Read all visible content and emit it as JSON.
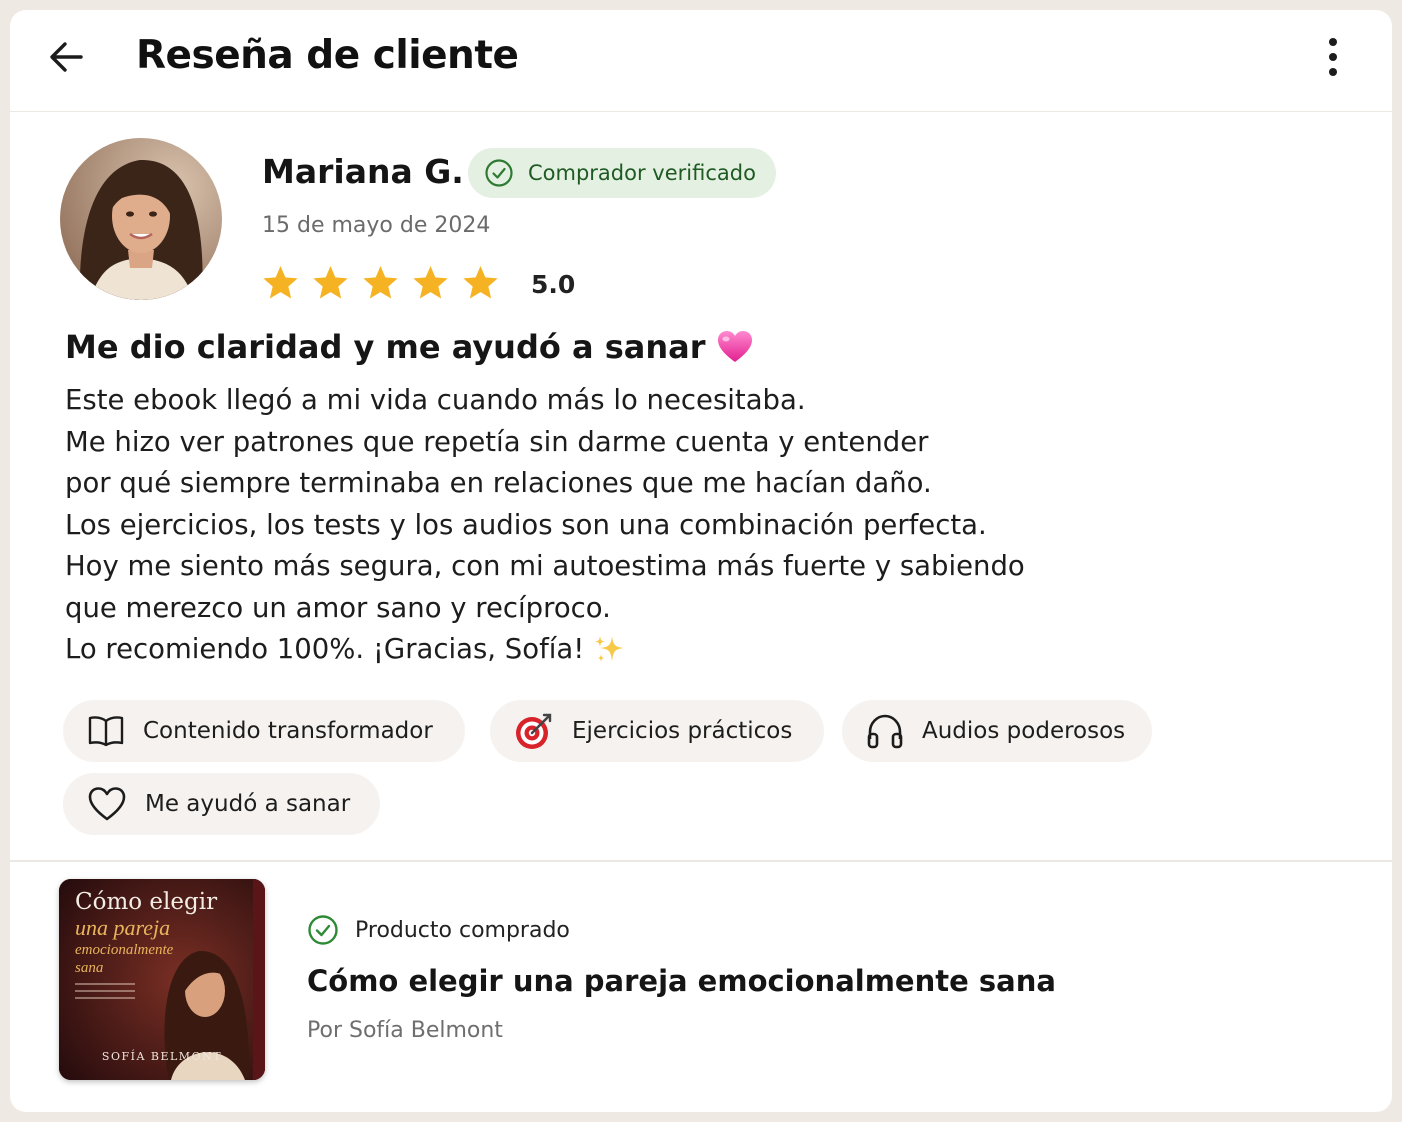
{
  "header": {
    "title": "Reseña de cliente",
    "back_icon": "arrow-left-icon",
    "menu_icon": "more-vertical-icon"
  },
  "reviewer": {
    "name": "Mariana G.",
    "verified_label": "Comprador verificado",
    "date": "15 de mayo de 2024",
    "rating": "5.0",
    "stars": 5
  },
  "review": {
    "title": "Me dio claridad y me ayudó a sanar",
    "body": [
      "Este ebook llegó a mi vida cuando más lo necesitaba.",
      "Me hizo ver patrones que repetía sin darme cuenta y entender",
      "por qué siempre terminaba en relaciones que me hacían daño.",
      "Los ejercicios, los tests y los audios son una combinación perfecta.",
      "Hoy me siento más segura, con mi autoestima más fuerte y sabiendo",
      "que merezco un amor sano y recíproco.",
      "Lo recomiendo 100%. ¡Gracias, Sofía!"
    ]
  },
  "tags": [
    {
      "label": "Contenido transformador",
      "icon": "book-icon"
    },
    {
      "label": "Ejercicios prácticos",
      "icon": "target-icon"
    },
    {
      "label": "Audios poderosos",
      "icon": "headphones-icon"
    },
    {
      "label": "Me ayudó a sanar",
      "icon": "heart-icon"
    }
  ],
  "product": {
    "purchased_label": "Producto comprado",
    "title": "Cómo elegir una pareja emocionalmente sana",
    "author": "Por Sofía Belmont",
    "cover": {
      "line1": "Cómo elegir",
      "line2": "una pareja",
      "line3": "emocionalmente",
      "line4": "sana",
      "author": "SOFÍA BELMONT"
    }
  },
  "colors": {
    "star": "#f5b324",
    "verified_bg": "#e4f1e2",
    "verified_text": "#1f5a23",
    "chip_bg": "#f6f2ef",
    "cover_accent": "#e8b45c"
  }
}
